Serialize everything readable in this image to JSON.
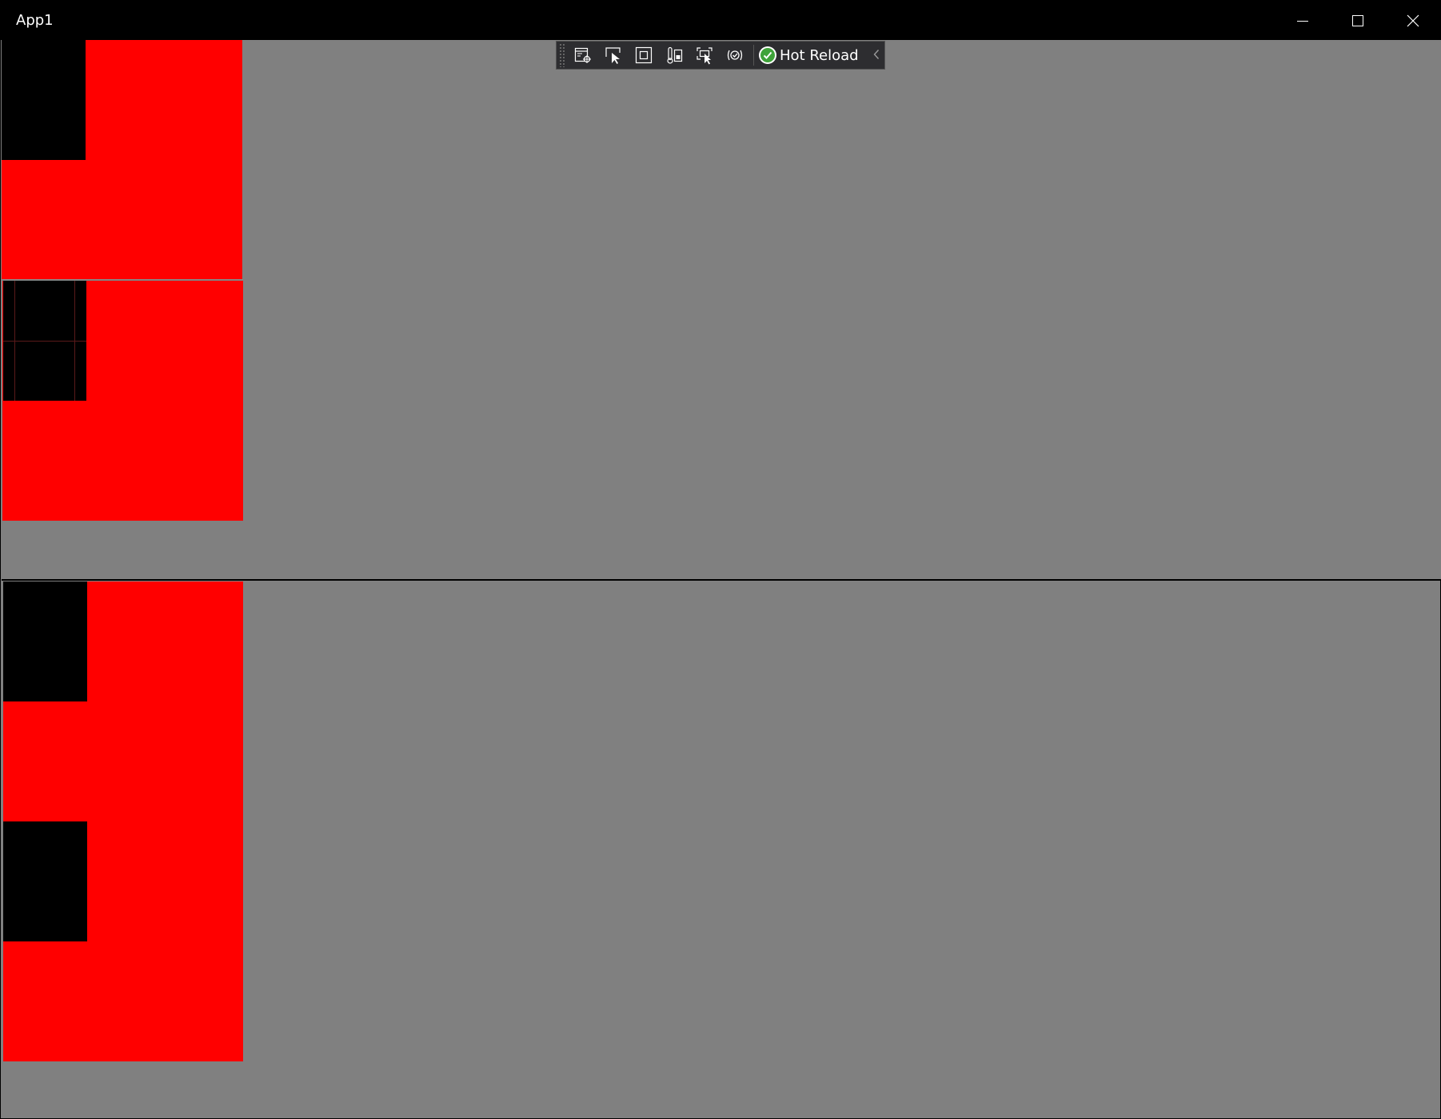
{
  "window": {
    "title": "App1",
    "controls": {
      "minimize": "minimize-icon",
      "maximize": "maximize-icon",
      "close": "close-icon"
    }
  },
  "toolbar": {
    "icons": [
      "live-visual-tree-icon",
      "select-element-icon",
      "display-layout-adorners-icon",
      "track-focus-icon",
      "preview-selection-icon",
      "binding-failures-icon"
    ],
    "hot_reload_label": "Hot Reload",
    "hot_reload_status_icon": "check-circle-icon",
    "collapse_icon": "chevron-left-icon"
  },
  "colors": {
    "titlebar": "#000000",
    "background": "#808080",
    "tile": "#ff0000",
    "block": "#000000",
    "toolbar": "#2d2d30",
    "status_ok": "#3fa33a"
  }
}
